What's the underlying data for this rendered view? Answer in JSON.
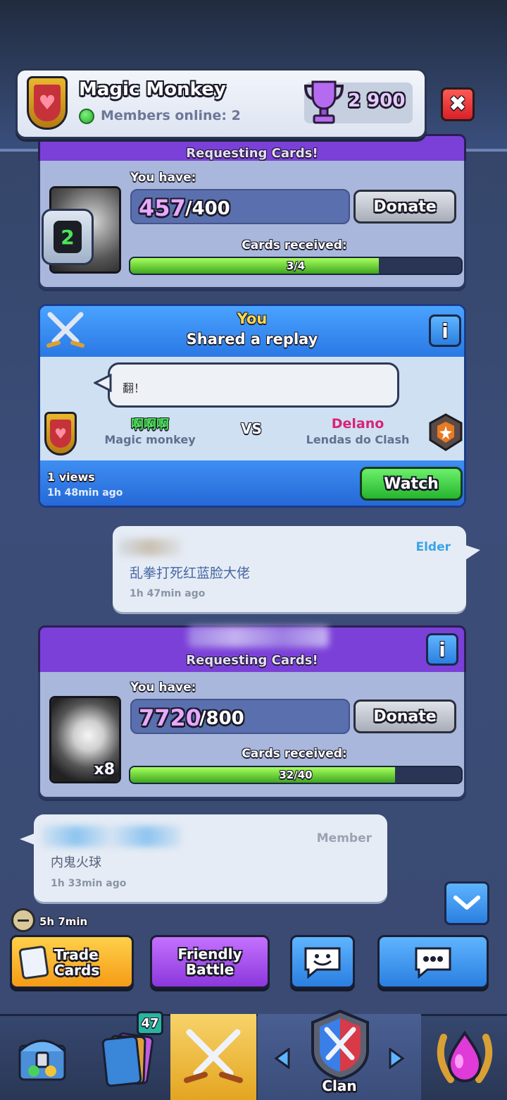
{
  "header": {
    "clan_name": "Magic Monkey",
    "members_online": "Members online: 2",
    "trophies": "2 900"
  },
  "request_top": {
    "title": "Requesting Cards!",
    "you_have_label": "You have:",
    "have": "457",
    "need": "/400",
    "donate_label": "Donate",
    "cards_received_label": "Cards received:",
    "received_text": "3/4",
    "received_fraction": 0.75,
    "level": "2"
  },
  "replay": {
    "you_label": "You",
    "shared_label": "Shared a replay",
    "info_label": "i",
    "comment": "翻！",
    "player1_name": "啊啊啊",
    "player1_clan": "Magic monkey",
    "vs_label": "VS",
    "player2_name": "Delano",
    "player2_clan": "Lendas do Clash",
    "views": "1 views",
    "time": "1h 48min ago",
    "watch_label": "Watch"
  },
  "chat1": {
    "role": "Elder",
    "message": "乱拳打死红蓝脸大佬",
    "time": "1h 47min ago"
  },
  "request_bottom": {
    "title": "Requesting Cards!",
    "info_label": "i",
    "you_have_label": "You have:",
    "have": "7720",
    "need": "/800",
    "donate_label": "Donate",
    "cards_received_label": "Cards received:",
    "received_text": "32/40",
    "received_fraction": 0.8,
    "card_multiplier": "x8"
  },
  "chat2": {
    "role": "Member",
    "message": "内鬼火球",
    "time": "1h 33min ago"
  },
  "timer": "5h 7min",
  "actions": {
    "trade_label": "Trade Cards",
    "friendly_label": "Friendly Battle"
  },
  "nav": {
    "cards_badge": "47",
    "clan_label": "Clan"
  },
  "colors": {
    "purple_header": "#7b40d8",
    "replay_blue": "#2a78e4",
    "green_button": "#26b52e",
    "trade_orange": "#f5a623"
  }
}
